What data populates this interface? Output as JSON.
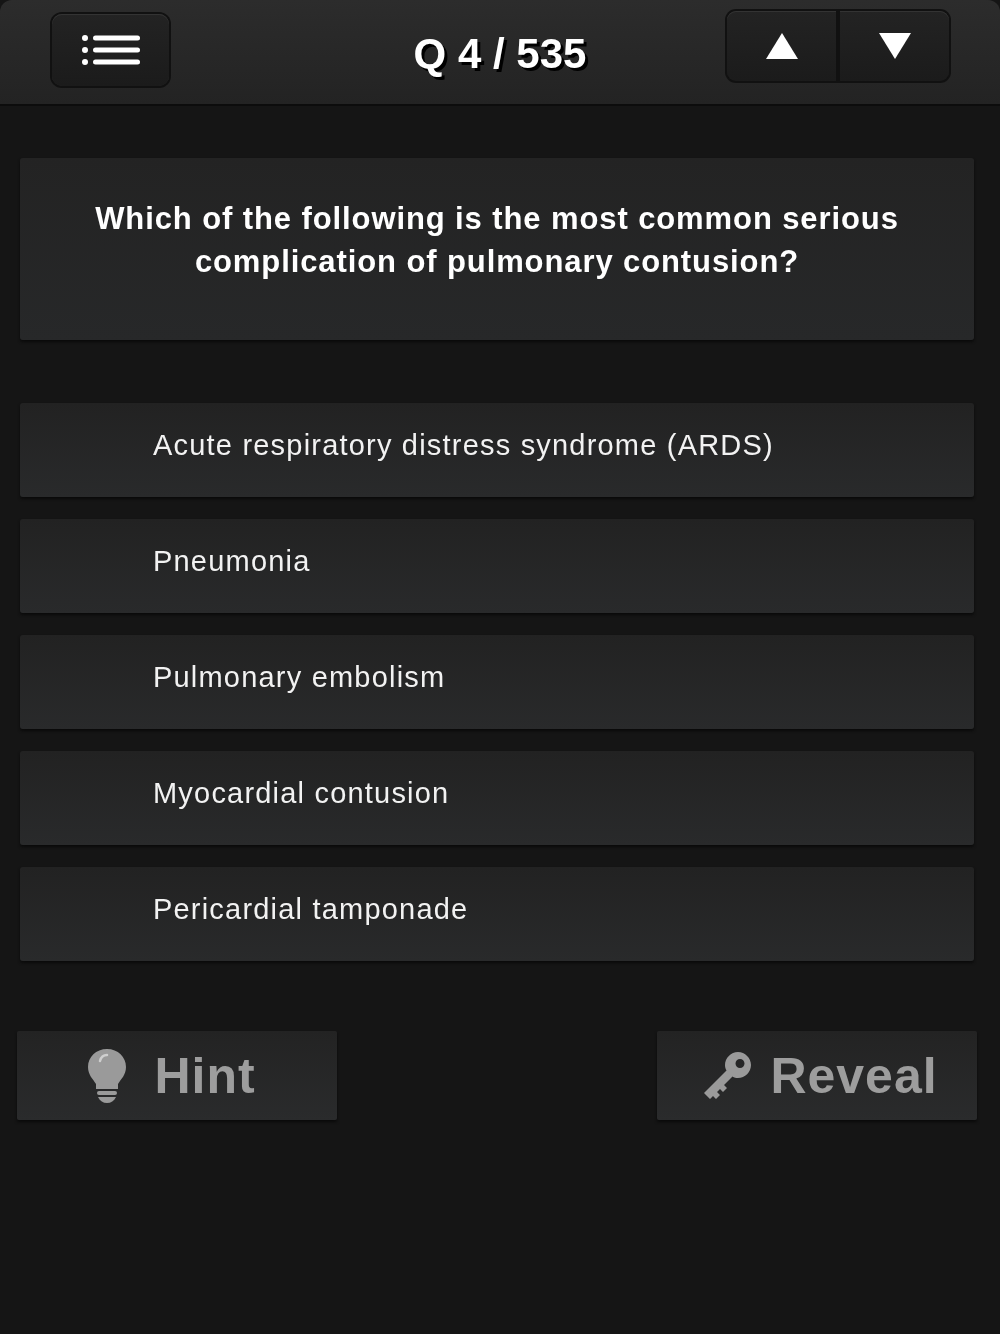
{
  "header": {
    "title": "Q 4 / 535"
  },
  "question": "Which of the following is the most common serious complication of pulmonary contusion?",
  "options": [
    {
      "text": "Acute respiratory distress syndrome (ARDS)"
    },
    {
      "text": "Pneumonia"
    },
    {
      "text": "Pulmonary embolism"
    },
    {
      "text": "Myocardial contusion"
    },
    {
      "text": "Pericardial tamponade"
    }
  ],
  "actions": [
    {
      "kind": "hint",
      "label": "Hint"
    },
    {
      "kind": "reveal",
      "label": "Reveal"
    }
  ]
}
